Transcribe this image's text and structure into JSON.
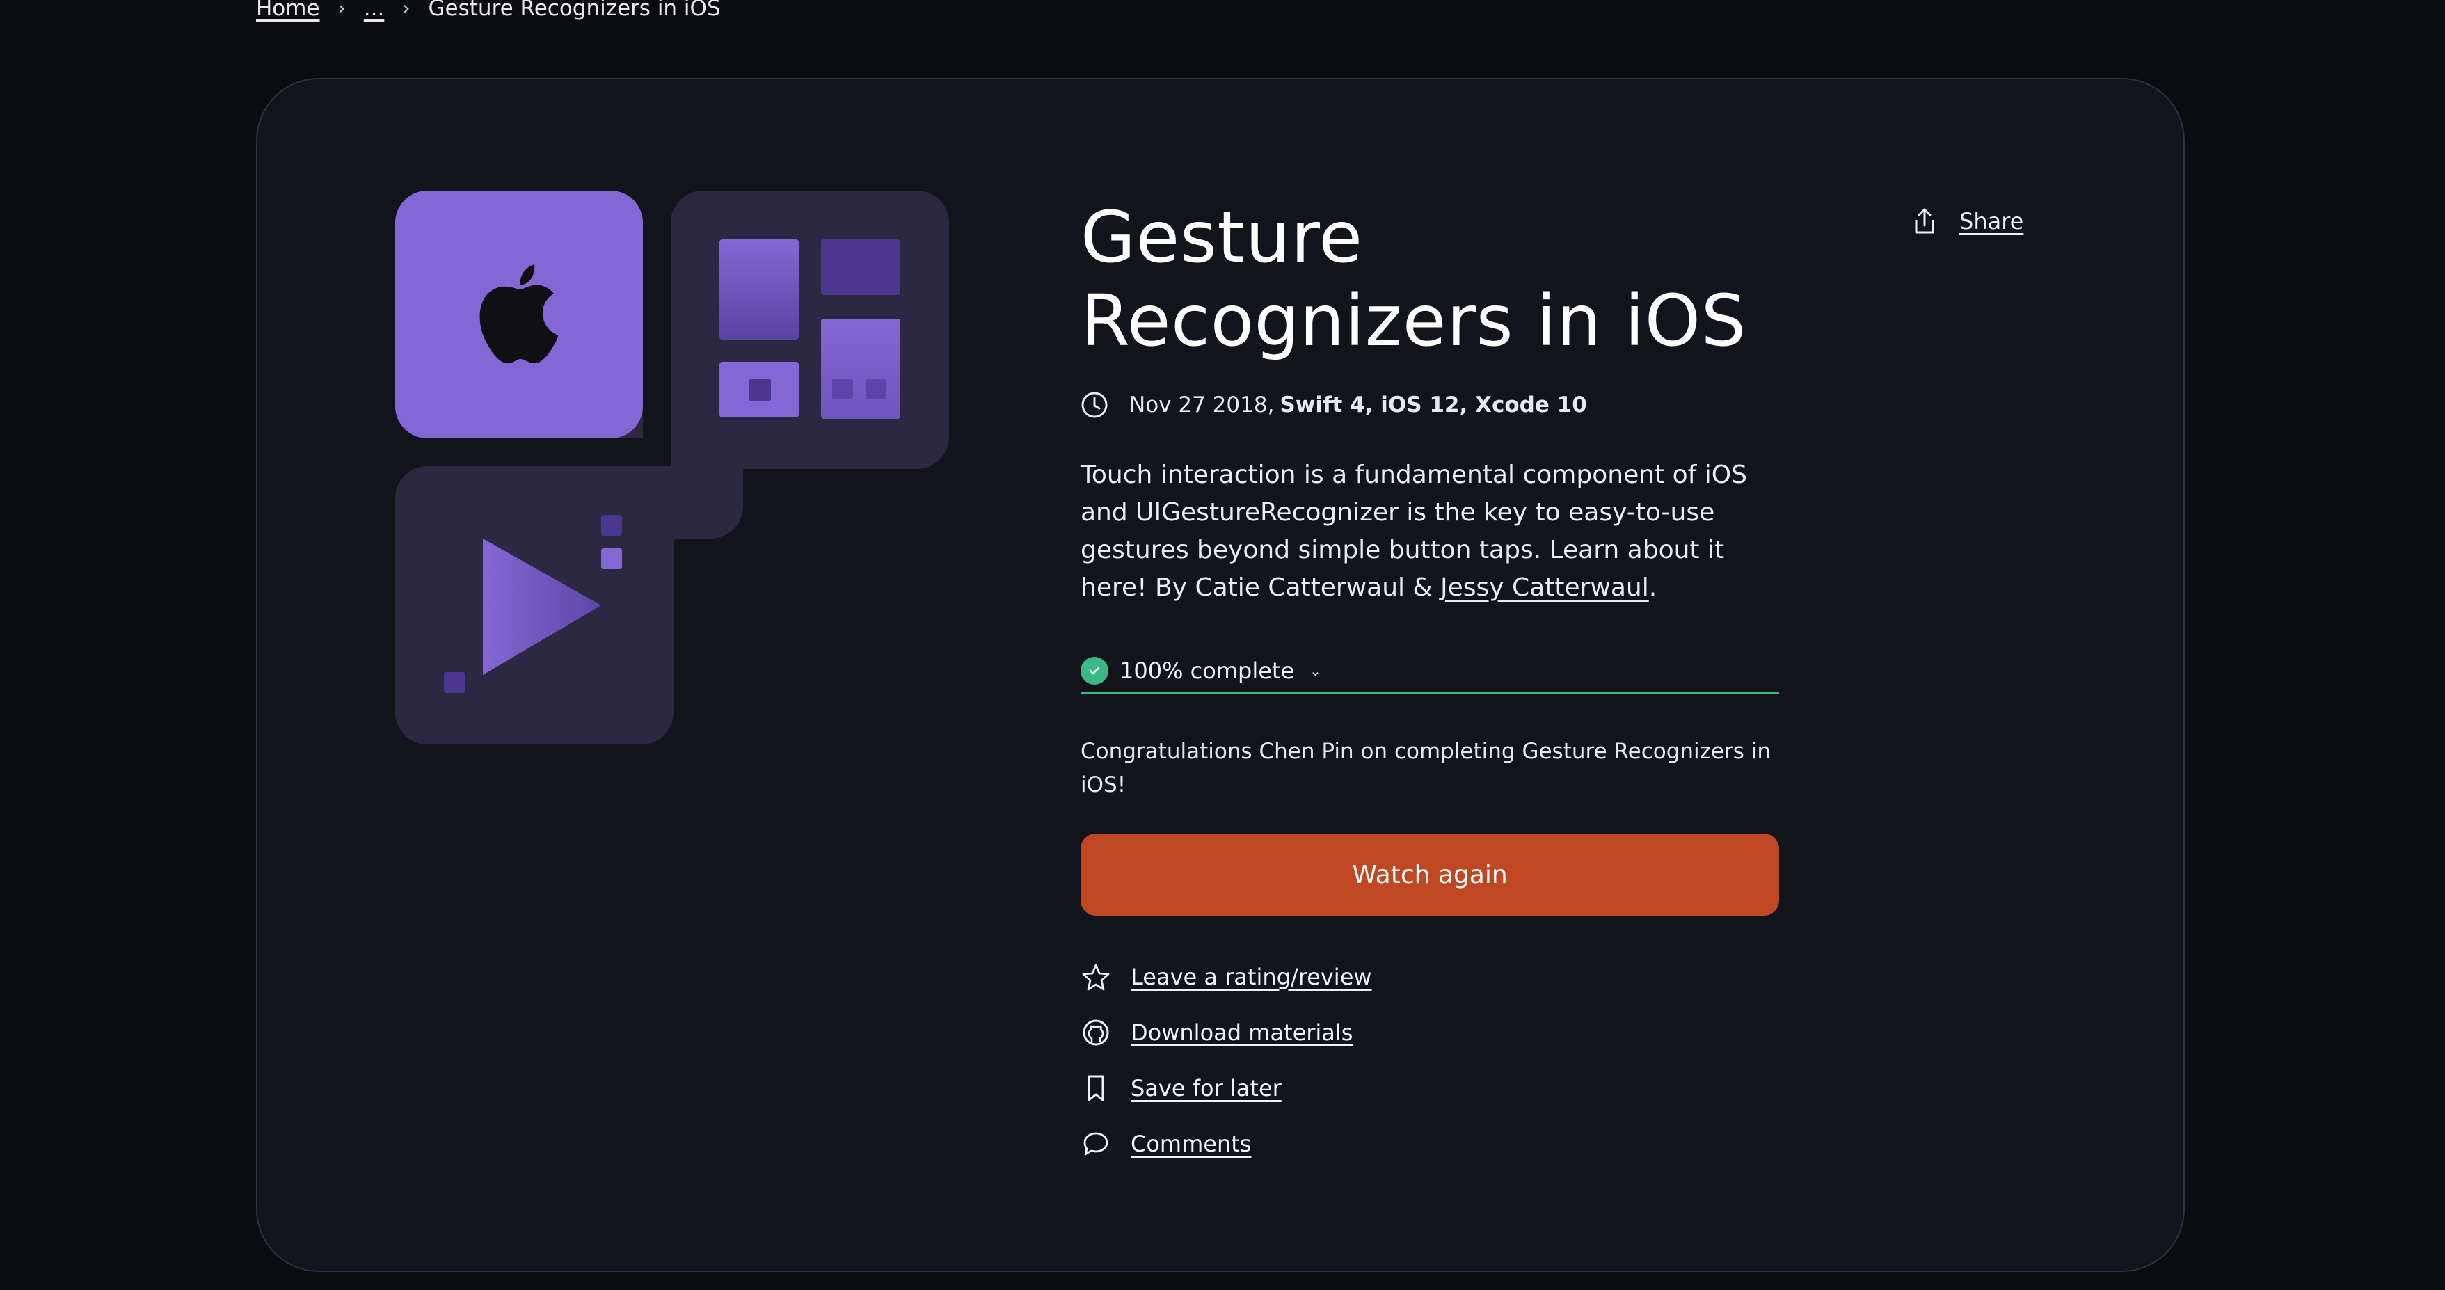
{
  "breadcrumb": {
    "home": "Home",
    "ellipsis": "...",
    "current": "Gesture Recognizers in iOS"
  },
  "course": {
    "title": "Gesture Recognizers in iOS",
    "date": "Nov 27 2018",
    "date_sep": " ,",
    "platform": "Swift 4, iOS 12, Xcode 10",
    "description_main": "Touch interaction is a fundamental component of iOS and UIGestureRecognizer is the key to easy-to-use gestures beyond simple button taps. Learn about it here! By Catie Catterwaul & ",
    "author_link": "Jessy Catterwaul",
    "description_end": "."
  },
  "progress": {
    "label": "100% complete",
    "value_percent": 100
  },
  "congrats": "Congratulations Chen Pin on completing Gesture Recognizers in iOS!",
  "buttons": {
    "watch_again": "Watch again",
    "share": "Share"
  },
  "actions": [
    {
      "label": "Leave a rating/review",
      "icon": "star-icon"
    },
    {
      "label": "Download materials",
      "icon": "github-icon"
    },
    {
      "label": "Save for later",
      "icon": "bookmark-icon"
    },
    {
      "label": "Comments",
      "icon": "comment-icon"
    }
  ],
  "colors": {
    "background": "#0b0c10",
    "card": "#11141b",
    "accent_purple": "#8467d4",
    "tile_dark": "#2c2841",
    "watch_button": "#bf4822",
    "progress_green": "#38b787"
  }
}
